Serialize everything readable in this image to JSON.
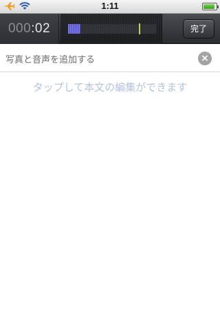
{
  "status_bar": {
    "time": "1:11",
    "icons": [
      "airplane-icon",
      "wifi-icon",
      "battery-icon"
    ],
    "battery_level_percent": 90
  },
  "recorder": {
    "timer_dim": "000",
    "timer_bright": ":02",
    "input_level_fraction": 0.14,
    "peak_fraction": 0.8,
    "level_color": "#6a68d8",
    "peak_color": "#b8d84a",
    "done_label": "完了"
  },
  "attachments": {
    "label": "写真と音声を追加する",
    "clear_icon": "clear-icon"
  },
  "body": {
    "placeholder": "タップして本文の編集ができます"
  }
}
